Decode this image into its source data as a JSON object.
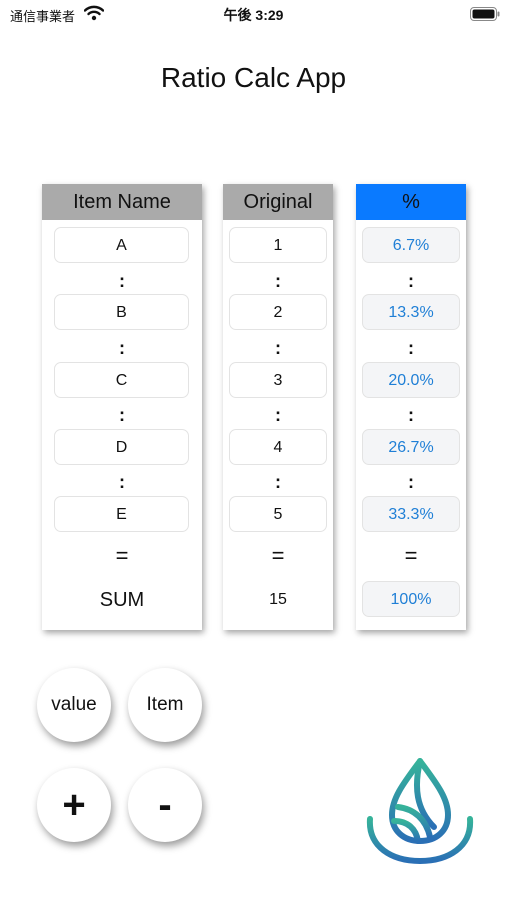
{
  "status_bar": {
    "carrier": "通信事業者",
    "time": "午後 3:29"
  },
  "app_title": "Ratio Calc App",
  "columns": {
    "item": {
      "header": "Item Name",
      "rows": [
        "A",
        "B",
        "C",
        "D",
        "E"
      ],
      "sum": "SUM"
    },
    "original": {
      "header": "Original",
      "rows": [
        "1",
        "2",
        "3",
        "4",
        "5"
      ],
      "sum": "15"
    },
    "percent": {
      "header": "%",
      "rows": [
        "6.7%",
        "13.3%",
        "20.0%",
        "26.7%",
        "33.3%"
      ],
      "sum": "100%"
    }
  },
  "separators": {
    "ratio": ":",
    "equals": "="
  },
  "buttons": {
    "value": "value",
    "item": "Item",
    "plus": "+",
    "minus": "-"
  },
  "colors": {
    "header_gray": "#aaaaaa",
    "header_blue": "#0a7aff",
    "percent_text": "#1f7fd6",
    "logo_teal": "#2aa39a",
    "logo_blue": "#2a78b8"
  },
  "icons": {
    "wifi": "wifi-icon",
    "battery": "battery-icon",
    "logo": "drop-logo-icon"
  }
}
